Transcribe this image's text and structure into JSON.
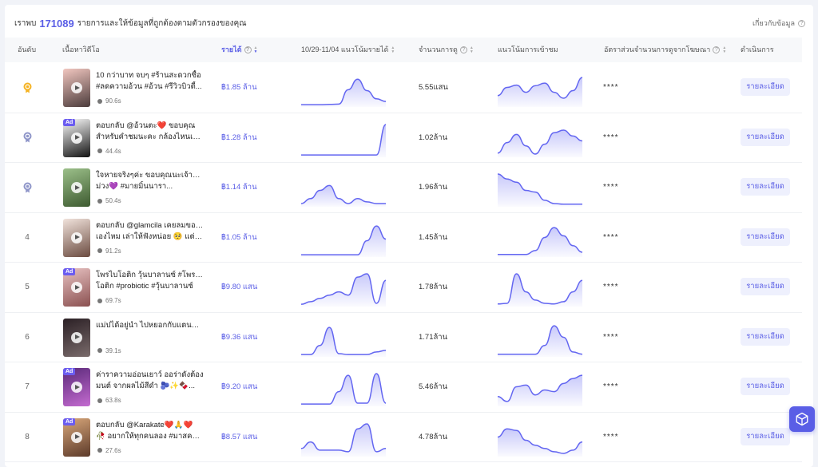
{
  "summary": {
    "prefix": "เราพบ",
    "count": "171089",
    "suffix": "รายการและให้ข้อมูลที่ถูกต้องตามตัวกรองของคุณ",
    "about_link": "เกี่ยวกับข้อมูล"
  },
  "table": {
    "headers": {
      "rank": "อันดับ",
      "content": "เนื้อหาวิดีโอ",
      "revenue": "รายได้",
      "trend_revenue": "10/29-11/04 แนวโน้มรายได้",
      "views": "จำนวนการดู",
      "trend_views": "แนวโน้มการเข้าชม",
      "ad_ratio": "อัตราส่วนจำนวนการดูจากโฆษณา",
      "action": "ดำเนินการ"
    },
    "rows": [
      {
        "rank": "1",
        "medal": "gold",
        "ad": false,
        "title_line1": "10 กว่าบาท จบๆ #ร้านสะดวกซื้อ",
        "title_line2": "#ลดความอ้วน #อ้วน #รีวิวบิวตี้...",
        "duration": "90.6s",
        "revenue": "฿1.85 ล้าน",
        "views": "5.55แสน",
        "ad_ratio": "****",
        "action": "รายละเอียด",
        "revenue_trend": [
          2,
          2,
          2,
          3,
          4,
          48,
          80,
          45,
          20,
          12
        ],
        "views_trend": [
          30,
          55,
          62,
          40,
          60,
          68,
          40,
          22,
          45,
          85
        ]
      },
      {
        "rank": "2",
        "medal": "silver",
        "ad": true,
        "title_line1": "ตอบกลับ @อ้วนตะ❤️ ขอบคุณ",
        "title_line2": "สำหรับคำชมนะคะ กล้องไหนเราส์...",
        "duration": "44.4s",
        "revenue": "฿1.28 ล้าน",
        "views": "1.02ล้าน",
        "ad_ratio": "****",
        "action": "รายละเอียด",
        "revenue_trend": [
          2,
          2,
          2,
          2,
          2,
          2,
          2,
          2,
          2,
          95
        ],
        "views_trend": [
          8,
          40,
          65,
          30,
          5,
          35,
          70,
          78,
          60,
          45
        ]
      },
      {
        "rank": "3",
        "medal": "bronze",
        "ad": false,
        "title_line1": "ใจหายจริงๆค่ะ ขอบคุณนะเจ้ากล่อง",
        "title_line2": "ม่วง💜 #มายมิ้นนารา...",
        "duration": "50.4s",
        "revenue": "฿1.14 ล้าน",
        "views": "1.96ล้าน",
        "ad_ratio": "****",
        "action": "รายละเอียด",
        "revenue_trend": [
          5,
          20,
          45,
          60,
          20,
          5,
          20,
          10,
          5,
          5
        ],
        "views_trend": [
          95,
          80,
          70,
          45,
          40,
          15,
          5,
          3,
          3,
          3
        ]
      },
      {
        "rank": "4",
        "medal": "",
        "ad": false,
        "title_line1": "ตอบกลับ @glamcila เคยลมของตัว",
        "title_line2": "เองไหม เล่าให้ฟังหน่อย 🥺 แต่ถ้า...",
        "duration": "91.2s",
        "revenue": "฿1.05 ล้าน",
        "views": "1.45ล้าน",
        "ad_ratio": "****",
        "action": "รายละเอียด",
        "revenue_trend": [
          2,
          2,
          2,
          2,
          2,
          2,
          2,
          45,
          90,
          50
        ],
        "views_trend": [
          3,
          3,
          3,
          3,
          15,
          55,
          85,
          60,
          30,
          10
        ]
      },
      {
        "rank": "5",
        "medal": "",
        "ad": true,
        "title_line1": "โพรไบโอติก วุ้นบาลานซ์ #โพรไบ",
        "title_line2": "โอติก #probiotic #วุ้นบาลานซ์",
        "duration": "69.7s",
        "revenue": "฿9.80 แสน",
        "views": "1.78ล้าน",
        "ad_ratio": "****",
        "action": "รายละเอียด",
        "revenue_trend": [
          2,
          10,
          20,
          30,
          40,
          30,
          85,
          95,
          5,
          75
        ],
        "views_trend": [
          3,
          5,
          95,
          40,
          15,
          5,
          3,
          10,
          40,
          75
        ]
      },
      {
        "rank": "6",
        "medal": "",
        "ad": false,
        "title_line1": "แม่ปได้อยู่นำ ไปหยอกกับแตนแล้ว",
        "title_line2": "",
        "duration": "39.1s",
        "revenue": "฿9.36 แสน",
        "views": "1.71ล้าน",
        "ad_ratio": "****",
        "action": "รายละเอียด",
        "revenue_trend": [
          2,
          2,
          30,
          85,
          5,
          2,
          2,
          2,
          10,
          15
        ],
        "views_trend": [
          3,
          3,
          3,
          3,
          3,
          30,
          90,
          55,
          10,
          3
        ]
      },
      {
        "rank": "7",
        "medal": "",
        "ad": true,
        "title_line1": "ค่าราความอ่อนเยาว์ ออร่าดังต้อง",
        "title_line2": "มนต์ จากผลไม้สีดำ 🫐✨🍫...",
        "duration": "63.8s",
        "revenue": "฿9.20 แสน",
        "views": "5.46ล้าน",
        "ad_ratio": "****",
        "action": "รายละเอียด",
        "revenue_trend": [
          2,
          2,
          2,
          2,
          40,
          90,
          5,
          5,
          95,
          5
        ],
        "views_trend": [
          25,
          10,
          55,
          60,
          30,
          45,
          40,
          65,
          80,
          90
        ]
      },
      {
        "rank": "8",
        "medal": "",
        "ad": true,
        "title_line1": "ตอบกลับ @Karakate❤️🙏❤️",
        "title_line2": "🥀 อยากให้ทุกคนลอง #มาสคาร่า...",
        "duration": "27.6s",
        "revenue": "฿8.57 แสน",
        "views": "4.78ล้าน",
        "ad_ratio": "****",
        "action": "รายละเอียด",
        "revenue_trend": [
          20,
          40,
          15,
          15,
          15,
          10,
          80,
          95,
          10,
          20
        ],
        "views_trend": [
          55,
          80,
          75,
          45,
          30,
          20,
          10,
          5,
          15,
          40
        ]
      }
    ]
  },
  "colors": {
    "accent": "#5a5ee6",
    "sparkline_stroke": "#6366f1",
    "sparkline_fill": "#dfe0fb",
    "gold": "#f5b323",
    "silver": "#8f96c9",
    "bronze": "#8f96c9"
  },
  "icons": {
    "fab": "cube-icon",
    "duration": "location-pin-icon",
    "help": "question-circle-icon"
  }
}
